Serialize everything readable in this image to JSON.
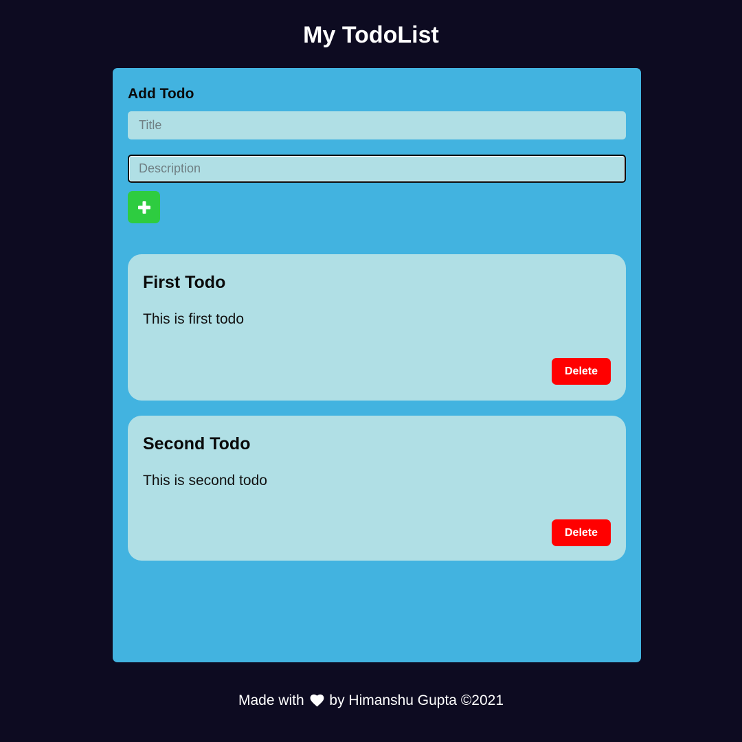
{
  "header": {
    "title": "My TodoList"
  },
  "add_form": {
    "heading": "Add Todo",
    "title_input": {
      "value": "",
      "placeholder": "Title"
    },
    "description_input": {
      "value": "",
      "placeholder": "Description"
    },
    "add_button_icon": "plus-icon"
  },
  "todos": [
    {
      "title": "First Todo",
      "description": "This is first todo",
      "delete_label": "Delete"
    },
    {
      "title": "Second Todo",
      "description": "This is second todo",
      "delete_label": "Delete"
    }
  ],
  "footer": {
    "text_before": "Made with",
    "icon": "heart-icon",
    "text_after": "by Himanshu Gupta ©2021"
  },
  "colors": {
    "background": "#0d0b21",
    "panel": "#42b3e0",
    "card": "#b0dfe5",
    "add_button": "#2ecc40",
    "delete_button": "#ff0000"
  }
}
